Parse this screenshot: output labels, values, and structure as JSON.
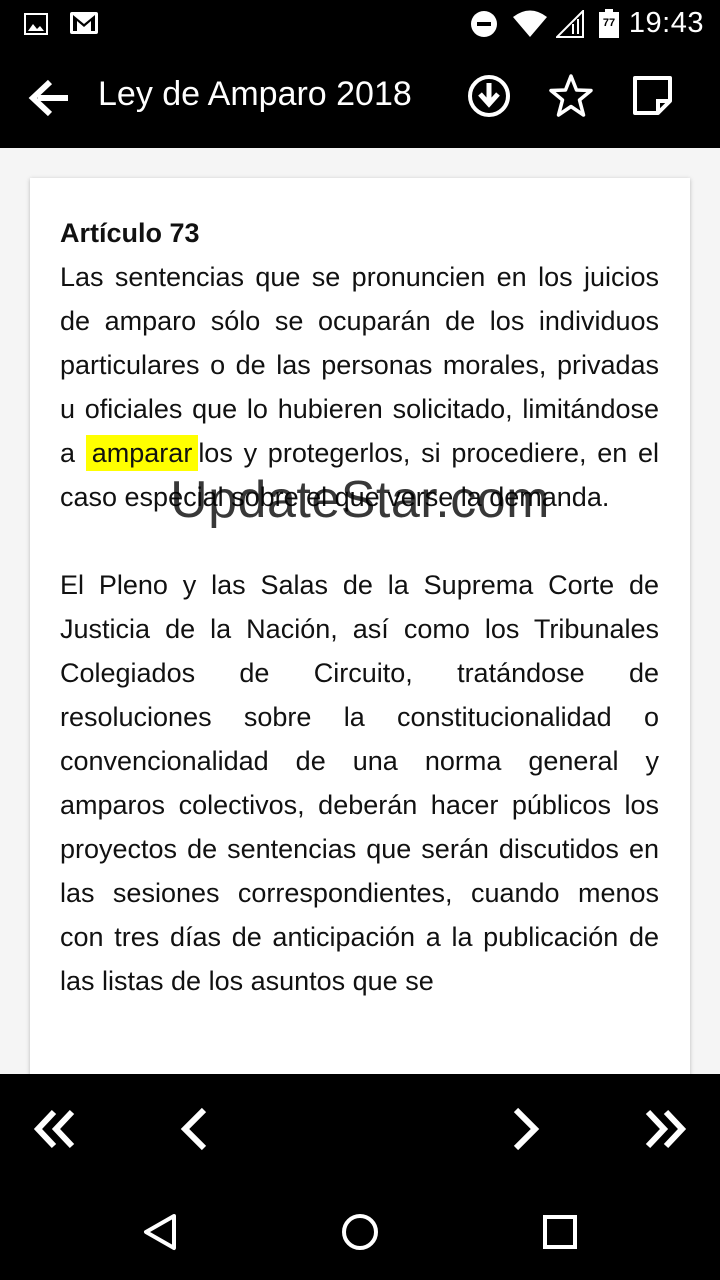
{
  "status_bar": {
    "time": "19:43",
    "battery_level": "77",
    "icons": [
      "image-icon",
      "gmail-icon",
      "do-not-disturb-icon",
      "wifi-icon",
      "signal-icon",
      "battery-icon"
    ]
  },
  "app_bar": {
    "title": "Ley de Amparo 2018",
    "actions": [
      "download-icon",
      "star-icon",
      "note-icon"
    ]
  },
  "article": {
    "title": "Artículo 73",
    "p1_before": "Las sentencias que se pronuncien en los juicios de amparo sólo se ocuparán de los individuos particulares o de las personas morales, privadas u oficiales que lo hubieren solicitado, limitándose a ",
    "p1_highlight": "amparar",
    "p1_after": "los y protegerlos, si procediere, en el caso especial sobre el que verse la demanda.",
    "p2": "El Pleno y las Salas de la Suprema Corte de Justicia de la Nación, así como los Tribunales Colegiados de Circuito, tratándose de resoluciones sobre la constitucionalidad o convencionalidad de una norma general y amparos colectivos, deberán hacer públicos los proyectos de sentencias que serán discutidos en las sesiones correspondientes, cuando menos con tres días de anticipación a la publicación de las listas de los asuntos que se"
  },
  "watermark": "UpdateStar.com",
  "nav": [
    "first-page-icon",
    "previous-icon",
    "next-icon",
    "last-page-icon"
  ],
  "colors": {
    "bar_background": "#000000",
    "highlight": "#ffff00",
    "content_background": "#f5f5f5"
  }
}
